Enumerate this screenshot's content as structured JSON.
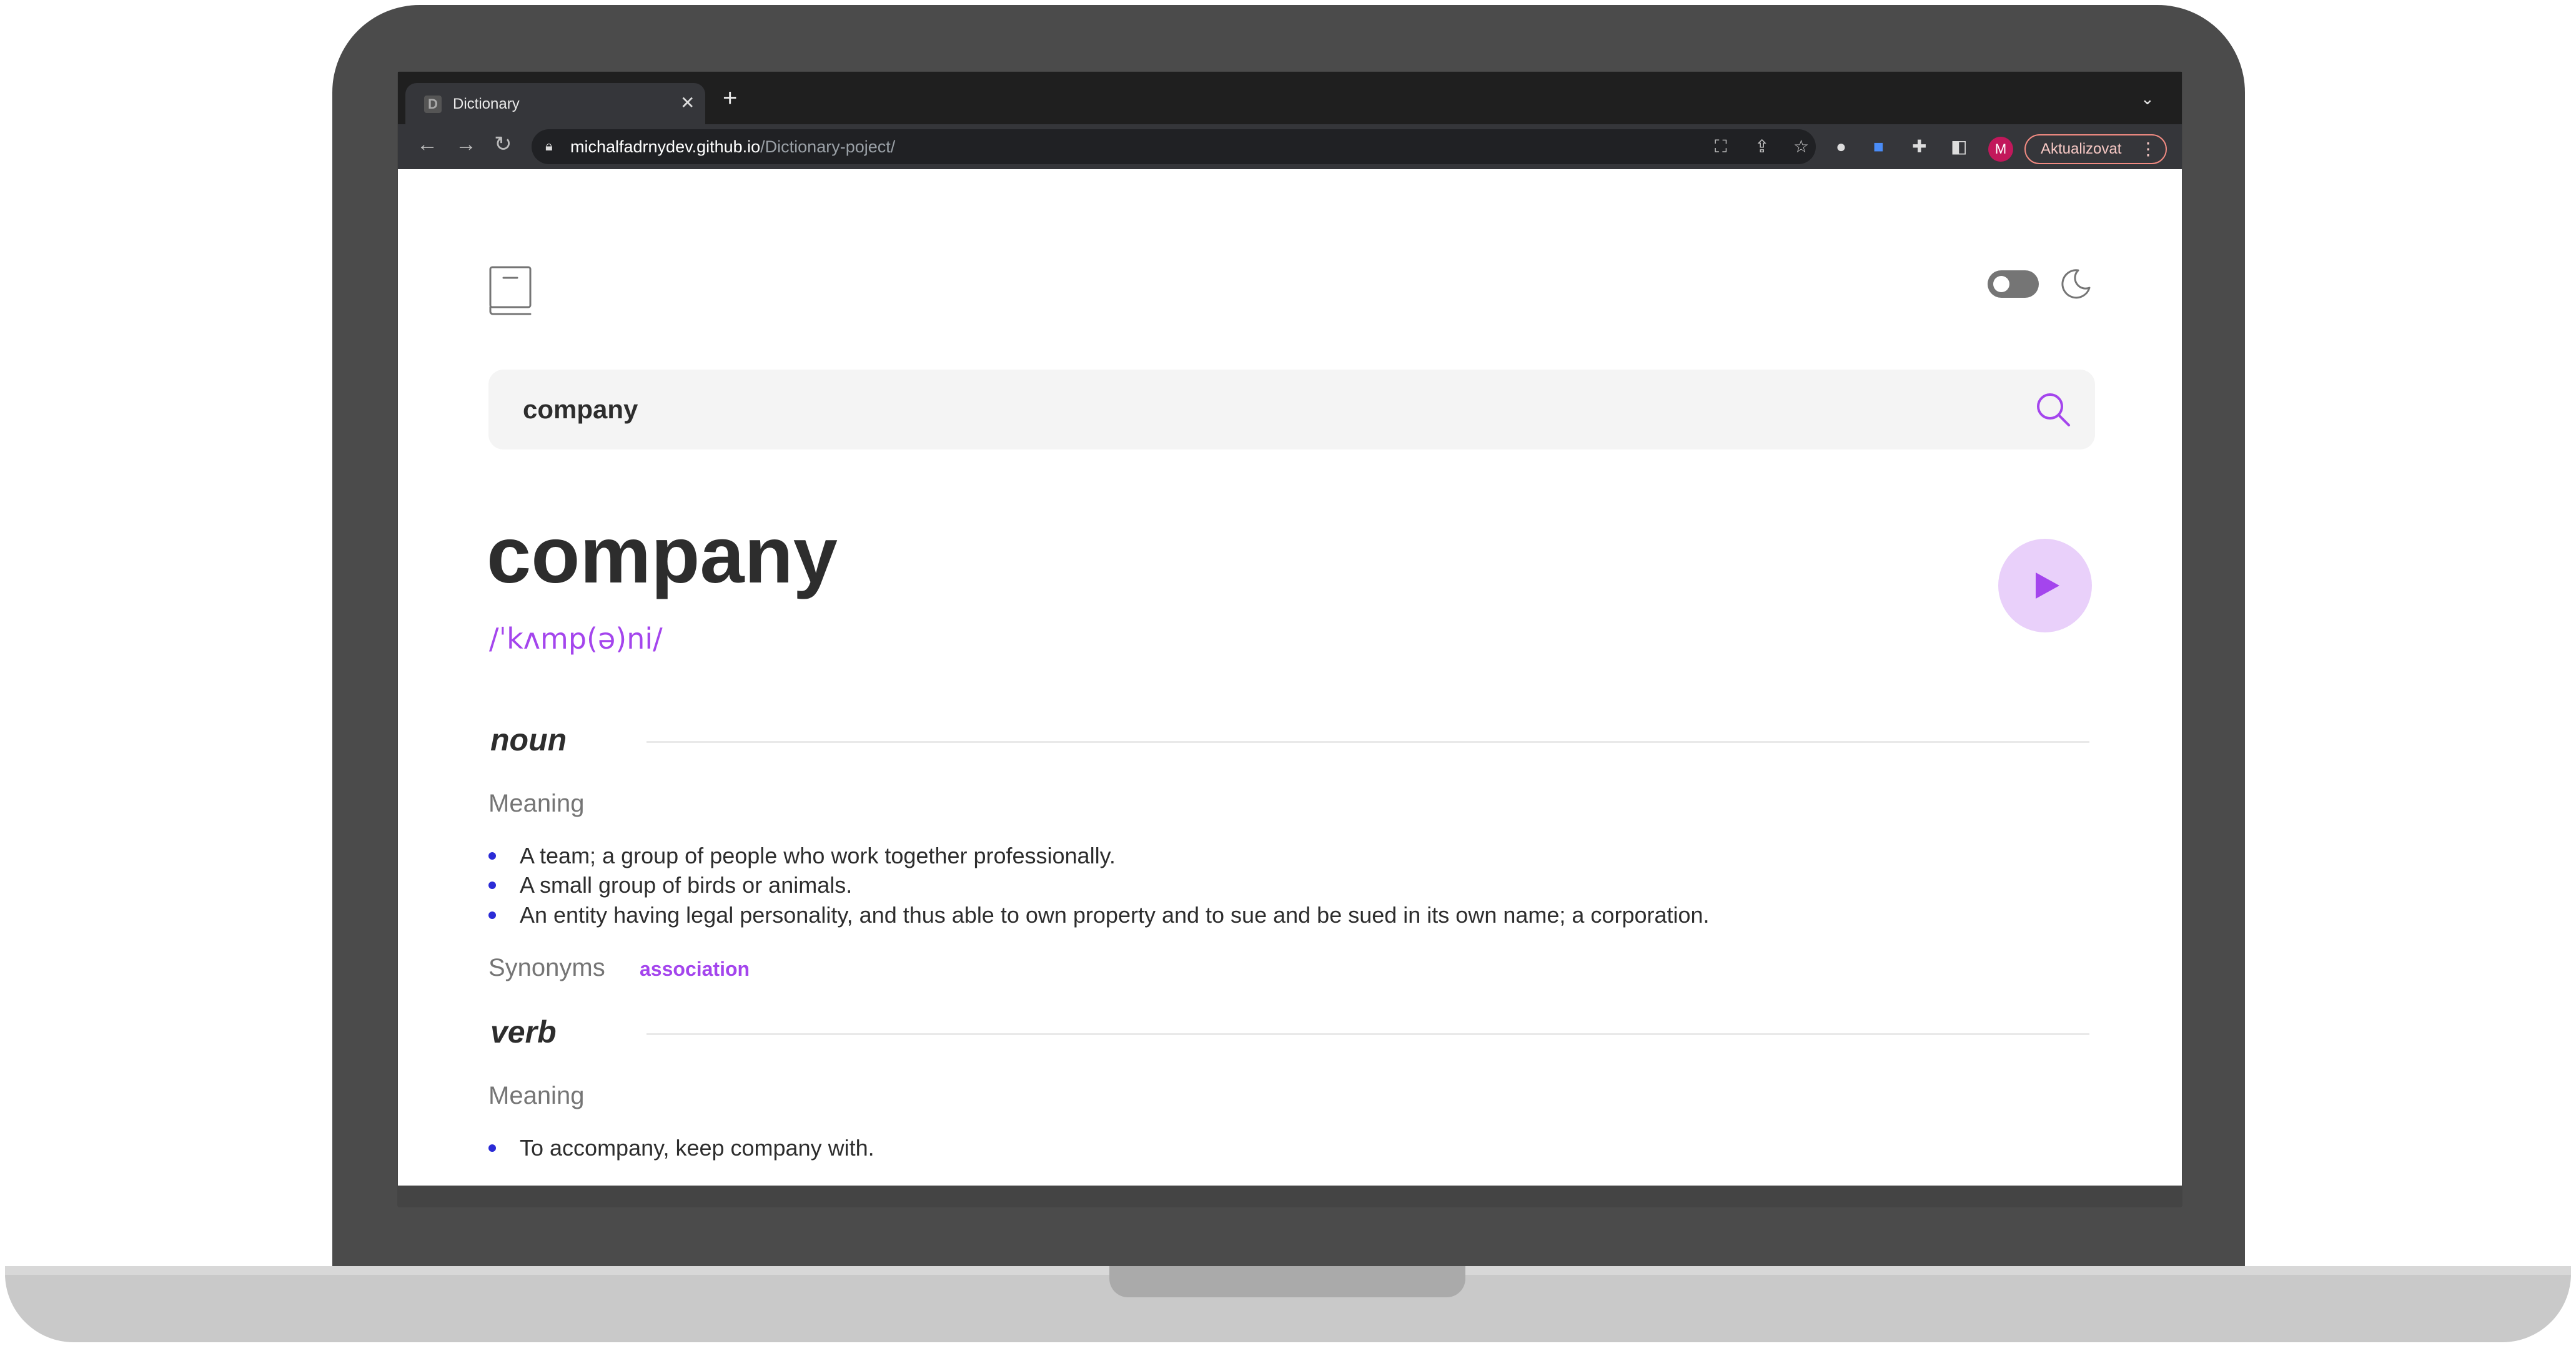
{
  "browser": {
    "tab_title": "Dictionary",
    "tab_favicon": "D",
    "url_host": "michalfadrnydev.github.io",
    "url_path": "/Dictionary-poject/",
    "profile_initial": "M",
    "update_label": "Aktualizovat"
  },
  "app": {
    "search": {
      "value": "company"
    },
    "word": "company",
    "phonetic": "/ˈkʌmp(ə)ni/",
    "sections": [
      {
        "part_of_speech": "noun",
        "meaning_label": "Meaning",
        "definitions": [
          "A team; a group of people who work together professionally.",
          "A small group of birds or animals.",
          "An entity having legal personality, and thus able to own property and to sue and be sued in its own name; a corporation."
        ],
        "synonyms_label": "Synonyms",
        "synonyms": [
          "association"
        ]
      },
      {
        "part_of_speech": "verb",
        "meaning_label": "Meaning",
        "definitions": [
          "To accompany, keep company with."
        ]
      }
    ]
  },
  "colors": {
    "accent": "#a445ed",
    "bullet": "#2b2bd6",
    "text": "#2d2d2d",
    "muted": "#757575"
  }
}
